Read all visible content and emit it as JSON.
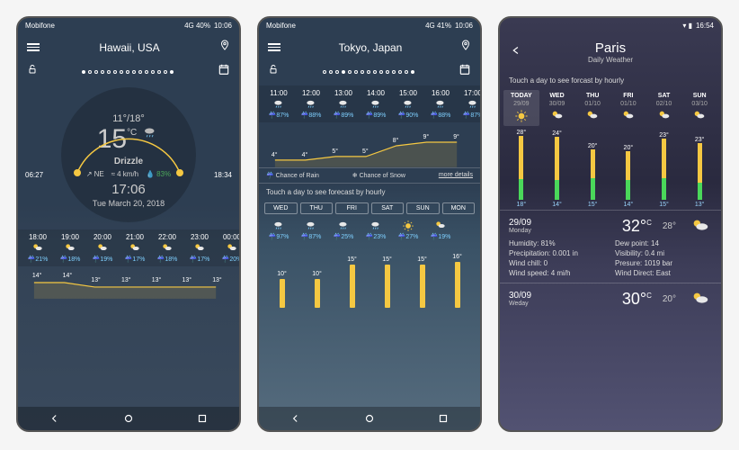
{
  "s1": {
    "carrier": "Mobifone",
    "signal": "4G 40%",
    "clock": "10:06",
    "location": "Hawaii, USA",
    "range": "11°/18°",
    "temp": "15",
    "unit": "°C",
    "condition": "Drizzle",
    "windDir": "NE",
    "windSpeed": "4 km/h",
    "humidity": "83%",
    "time": "17:06",
    "date": "Tue March 20, 2018",
    "sunrise": "06:27",
    "sunset": "18:34",
    "hourly": [
      {
        "t": "18:00",
        "p": "21%"
      },
      {
        "t": "19:00",
        "p": "18%"
      },
      {
        "t": "20:00",
        "p": "19%"
      },
      {
        "t": "21:00",
        "p": "17%"
      },
      {
        "t": "22:00",
        "p": "18%"
      },
      {
        "t": "23:00",
        "p": "17%"
      },
      {
        "t": "00:00",
        "p": "20%"
      }
    ],
    "chart_data": {
      "type": "line",
      "x": [
        "18:00",
        "19:00",
        "20:00",
        "21:00",
        "22:00",
        "23:00",
        "00:00"
      ],
      "values": [
        14,
        14,
        13,
        13,
        13,
        13,
        13
      ],
      "ylabel": "°"
    }
  },
  "s2": {
    "carrier": "Mobifone",
    "signal": "4G 41%",
    "clock": "10:06",
    "location": "Tokyo, Japan",
    "hourly": [
      {
        "t": "11:00",
        "p": "87%"
      },
      {
        "t": "12:00",
        "p": "88%"
      },
      {
        "t": "13:00",
        "p": "89%"
      },
      {
        "t": "14:00",
        "p": "89%"
      },
      {
        "t": "15:00",
        "p": "90%"
      },
      {
        "t": "16:00",
        "p": "88%"
      },
      {
        "t": "17:00",
        "p": "87%"
      }
    ],
    "chart_data": {
      "type": "line",
      "x": [
        "11:00",
        "12:00",
        "13:00",
        "14:00",
        "15:00",
        "16:00",
        "17:00"
      ],
      "values": [
        4,
        4,
        5,
        5,
        8,
        9,
        9
      ],
      "ylabel": "°"
    },
    "legend": {
      "rain": "Chance of Rain",
      "snow": "Chance of Snow",
      "more": "more details"
    },
    "touch": "Touch a day to see forecast by hourly",
    "days": [
      {
        "n": "WED",
        "p": "97%"
      },
      {
        "n": "THU",
        "p": "87%"
      },
      {
        "n": "FRI",
        "p": "25%"
      },
      {
        "n": "SAT",
        "p": "23%"
      },
      {
        "n": "SUN",
        "p": "27%"
      },
      {
        "n": "MON",
        "p": "19%"
      }
    ],
    "bars": {
      "type": "bar",
      "categories": [
        "WED",
        "THU",
        "FRI",
        "SAT",
        "SUN",
        "MON"
      ],
      "values": [
        10,
        10,
        15,
        15,
        15,
        16
      ],
      "ylabel": "°"
    }
  },
  "s3": {
    "clock": "16:54",
    "city": "Paris",
    "subtitle": "Daily Weather",
    "touch": "Touch a day to see forcast by hourly",
    "days": [
      {
        "n": "TODAY",
        "d": "29/09",
        "hi": "28°",
        "lo": "18°",
        "ic": "sun"
      },
      {
        "n": "WED",
        "d": "30/09",
        "hi": "24°",
        "lo": "14°",
        "ic": "pc"
      },
      {
        "n": "THU",
        "d": "01/10",
        "hi": "20°",
        "lo": "15°",
        "ic": "pc"
      },
      {
        "n": "FRI",
        "d": "01/10",
        "hi": "20°",
        "lo": "14°",
        "ic": "pc"
      },
      {
        "n": "SAT",
        "d": "02/10",
        "hi": "23°",
        "lo": "15°",
        "ic": "pc"
      },
      {
        "n": "SUN",
        "d": "03/10",
        "hi": "23°",
        "lo": "13°",
        "ic": "pc"
      }
    ],
    "chart_data": {
      "type": "bar",
      "categories": [
        "TODAY",
        "WED",
        "THU",
        "FRI",
        "SAT",
        "SUN"
      ],
      "series": [
        {
          "name": "high",
          "values": [
            28,
            24,
            20,
            20,
            23,
            23
          ]
        },
        {
          "name": "low",
          "values": [
            18,
            14,
            15,
            14,
            15,
            13
          ]
        }
      ]
    },
    "d1": {
      "date": "29/09",
      "day": "Monday",
      "hi": "32°",
      "unit": "C",
      "lo": "28°",
      "humidity": "Humidity: 81%",
      "dew": "Dew point: 14",
      "precip": "Precipitation: 0.001 in",
      "vis": "Visibility: 0.4 mi",
      "chill": "Wind chill: 0",
      "pres": "Presure: 1019 bar",
      "wspd": "Wind speed: 4 mi/h",
      "wdir": "Wind Direct: East"
    },
    "d2": {
      "date": "30/09",
      "day": "Weday",
      "hi": "30°",
      "unit": "C",
      "lo": "20°"
    }
  }
}
